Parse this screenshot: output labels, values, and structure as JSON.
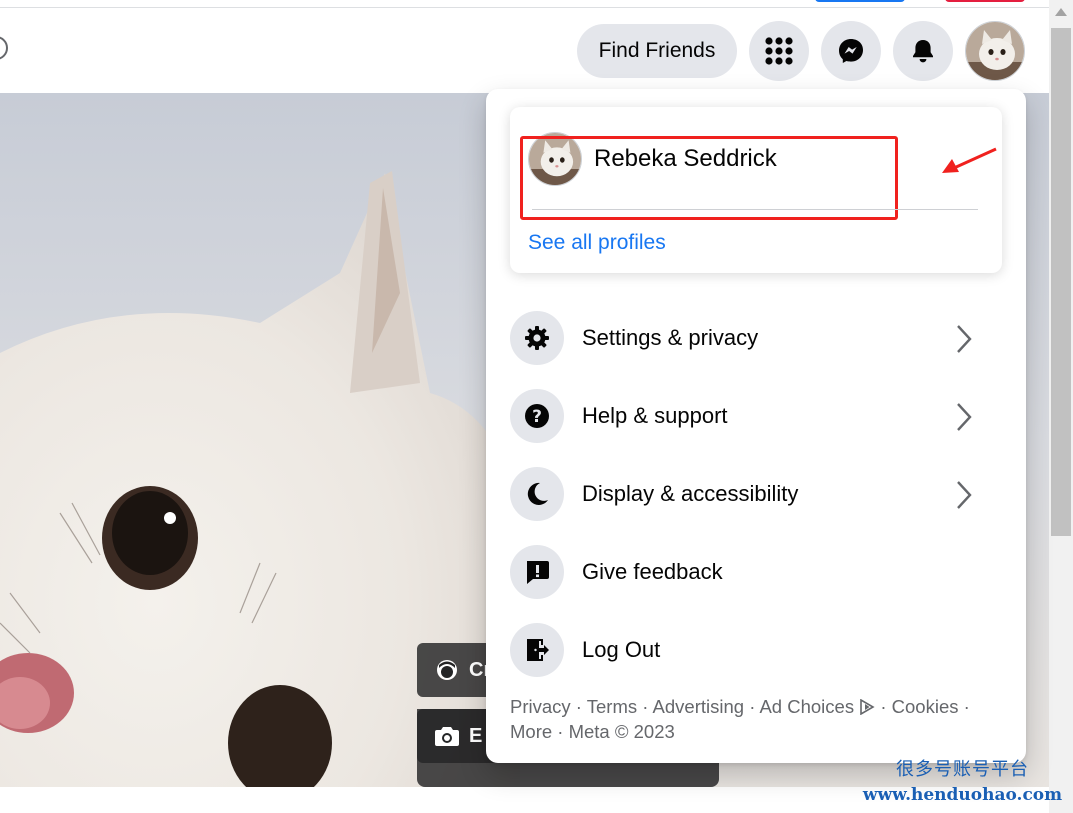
{
  "header": {
    "find_friends_label": "Find Friends",
    "menu_icon": "menu-grid-icon",
    "messenger_icon": "messenger-icon",
    "notifications_icon": "bell-icon"
  },
  "cover": {
    "button_1_label": "Cr",
    "button_1_icon": "avatar-icon",
    "button_2_label": "E",
    "button_2_icon": "camera-icon"
  },
  "dropdown": {
    "profile": {
      "name": "Rebeka Seddrick",
      "see_all_label": "See all profiles"
    },
    "items": [
      {
        "label": "Settings & privacy",
        "icon": "gear-icon",
        "has_chevron": true
      },
      {
        "label": "Help & support",
        "icon": "question-icon",
        "has_chevron": true
      },
      {
        "label": "Display & accessibility",
        "icon": "moon-icon",
        "has_chevron": true
      },
      {
        "label": "Give feedback",
        "icon": "feedback-icon",
        "has_chevron": false
      },
      {
        "label": "Log Out",
        "icon": "logout-icon",
        "has_chevron": false
      }
    ],
    "footer": {
      "line1": "Privacy · Terms · Advertising · Ad Choices",
      "cookies": "· Cookies ·",
      "line2": "More · Meta © 2023"
    }
  },
  "watermark": {
    "line1": "很多号账号平台",
    "line2": "www.henduohao.com"
  },
  "colors": {
    "accent": "#1877f2",
    "highlight": "#f0211e",
    "button_bg": "#e4e6eb",
    "muted_text": "#65676b"
  }
}
